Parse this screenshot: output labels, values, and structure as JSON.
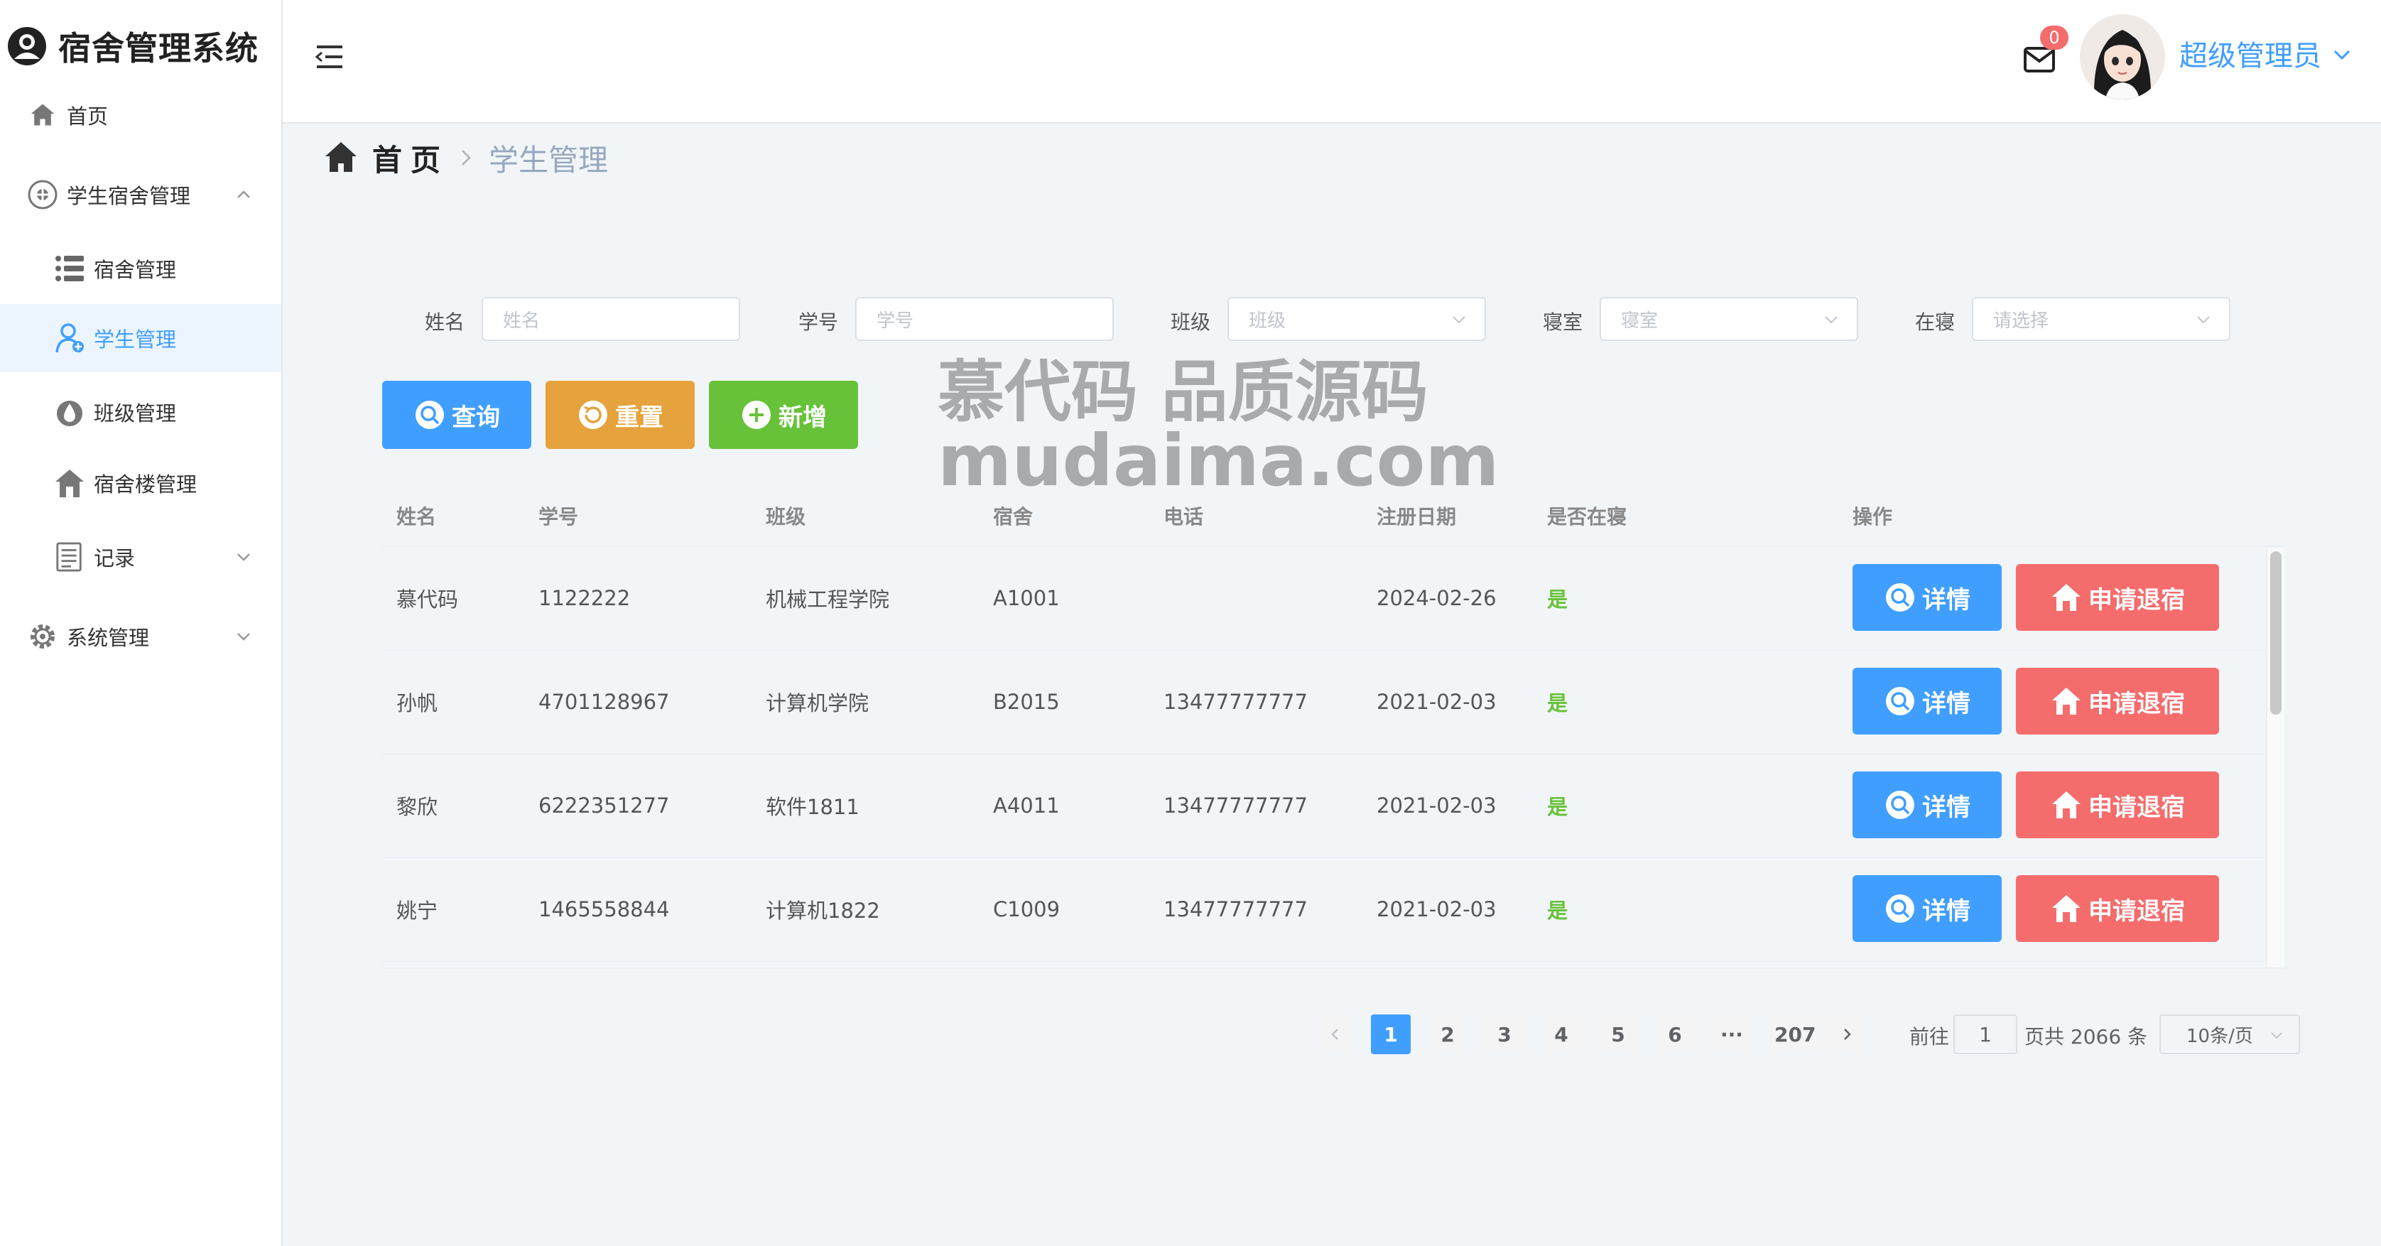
{
  "app": {
    "title": "宿舍管理系统"
  },
  "sidebar": {
    "items": [
      {
        "label": "首页"
      },
      {
        "label": "学生宿舍管理"
      },
      {
        "label": "宿舍管理"
      },
      {
        "label": "学生管理"
      },
      {
        "label": "班级管理"
      },
      {
        "label": "宿舍楼管理"
      },
      {
        "label": "记录"
      },
      {
        "label": "系统管理"
      }
    ]
  },
  "header": {
    "mail_count": "0",
    "username": "超级管理员"
  },
  "breadcrumb": {
    "home": "首页",
    "current": "学生管理"
  },
  "filters": {
    "name": {
      "label": "姓名",
      "placeholder": "姓名"
    },
    "student_id": {
      "label": "学号",
      "placeholder": "学号"
    },
    "class": {
      "label": "班级",
      "placeholder": "班级"
    },
    "room": {
      "label": "寝室",
      "placeholder": "寝室"
    },
    "in_dorm": {
      "label": "在寝",
      "placeholder": "请选择"
    }
  },
  "actions": {
    "query": "查询",
    "reset": "重置",
    "add": "新增"
  },
  "table": {
    "columns": [
      "姓名",
      "学号",
      "班级",
      "宿舍",
      "电话",
      "注册日期",
      "是否在寝",
      "操作"
    ],
    "rows": [
      {
        "name": "慕代码",
        "id": "1122222",
        "class": "机械工程学院",
        "room": "A1001",
        "phone": "",
        "date": "2024-02-26",
        "in_dorm": "是"
      },
      {
        "name": "孙帆",
        "id": "4701128967",
        "class": "计算机学院",
        "room": "B2015",
        "phone": "13477777777",
        "date": "2021-02-03",
        "in_dorm": "是"
      },
      {
        "name": "黎欣",
        "id": "6222351277",
        "class": "软件1811",
        "room": "A4011",
        "phone": "13477777777",
        "date": "2021-02-03",
        "in_dorm": "是"
      },
      {
        "name": "姚宁",
        "id": "1465558844",
        "class": "计算机1822",
        "room": "C1009",
        "phone": "13477777777",
        "date": "2021-02-03",
        "in_dorm": "是"
      }
    ],
    "detail_label": "详情",
    "checkout_label": "申请退宿"
  },
  "pagination": {
    "pages": [
      "1",
      "2",
      "3",
      "4",
      "5",
      "6",
      "···",
      "207"
    ],
    "goto_label": "前往",
    "goto_value": "1",
    "total_label": "页共 2066 条",
    "page_size": "10条/页"
  },
  "watermark": {
    "line1": "慕代码 品质源码",
    "line2": "mudaima.com"
  }
}
